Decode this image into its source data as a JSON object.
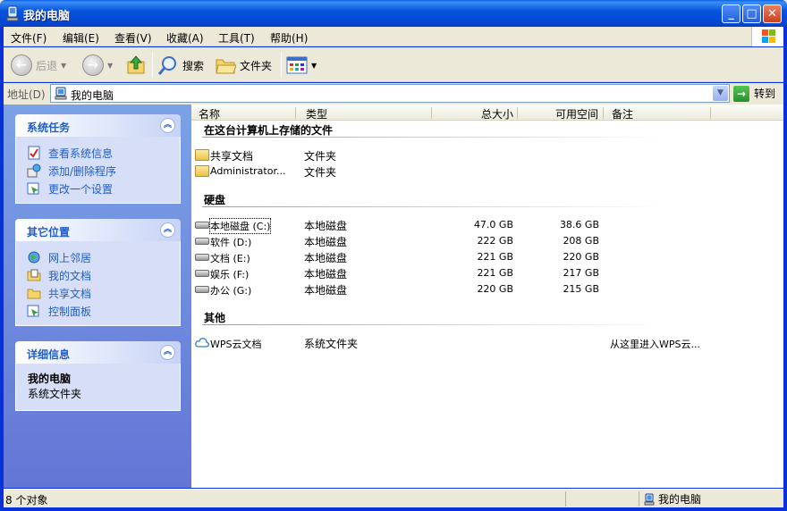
{
  "window": {
    "title": "我的电脑"
  },
  "menu": [
    "文件(F)",
    "编辑(E)",
    "查看(V)",
    "收藏(A)",
    "工具(T)",
    "帮助(H)"
  ],
  "toolbar": {
    "back": "后退",
    "search": "搜索",
    "folders": "文件夹"
  },
  "address": {
    "label": "地址(D)",
    "value": "我的电脑",
    "go": "转到"
  },
  "sidebar": {
    "system_tasks": {
      "title": "系统任务",
      "items": [
        "查看系统信息",
        "添加/删除程序",
        "更改一个设置"
      ]
    },
    "other_places": {
      "title": "其它位置",
      "items": [
        "网上邻居",
        "我的文档",
        "共享文档",
        "控制面板"
      ]
    },
    "details": {
      "title": "详细信息",
      "name": "我的电脑",
      "type": "系统文件夹"
    }
  },
  "columns": {
    "name": "名称",
    "type": "类型",
    "total": "总大小",
    "free": "可用空间",
    "note": "备注"
  },
  "groups": {
    "stored": {
      "title": "在这台计算机上存储的文件",
      "items": [
        {
          "name": "共享文档",
          "type": "文件夹"
        },
        {
          "name": "Administrator...",
          "type": "文件夹"
        }
      ]
    },
    "drives": {
      "title": "硬盘",
      "items": [
        {
          "name": "本地磁盘 (C:)",
          "type": "本地磁盘",
          "total": "47.0 GB",
          "free": "38.6 GB"
        },
        {
          "name": "软件 (D:)",
          "type": "本地磁盘",
          "total": "222 GB",
          "free": "208 GB"
        },
        {
          "name": "文档 (E:)",
          "type": "本地磁盘",
          "total": "221 GB",
          "free": "220 GB"
        },
        {
          "name": "娱乐 (F:)",
          "type": "本地磁盘",
          "total": "221 GB",
          "free": "217 GB"
        },
        {
          "name": "办公 (G:)",
          "type": "本地磁盘",
          "total": "220 GB",
          "free": "215 GB"
        }
      ]
    },
    "other": {
      "title": "其他",
      "items": [
        {
          "name": "WPS云文档",
          "type": "系统文件夹",
          "note": "从这里进入WPS云..."
        }
      ]
    }
  },
  "status": {
    "count": "8 个对象",
    "location": "我的电脑"
  }
}
